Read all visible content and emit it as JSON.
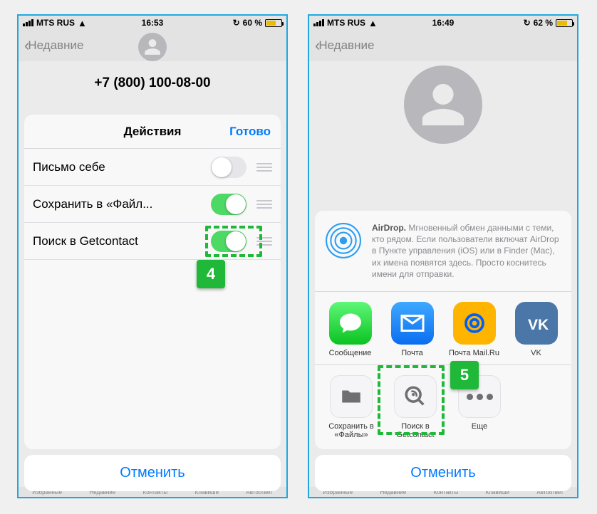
{
  "left": {
    "status": {
      "carrier": "MTS RUS",
      "time": "16:53",
      "battery_pct": "60 %"
    },
    "nav": {
      "back": "Недавние"
    },
    "phone_number": "+7 (800) 100-08-00",
    "actions_title": "Действия",
    "done": "Готово",
    "rows": [
      {
        "label": "Письмо себе",
        "on": false
      },
      {
        "label": "Сохранить в «Файл...",
        "on": true
      },
      {
        "label": "Поиск в Getcontact",
        "on": true
      }
    ],
    "cancel": "Отменить",
    "badge": "4"
  },
  "right": {
    "status": {
      "carrier": "MTS RUS",
      "time": "16:49",
      "battery_pct": "62 %"
    },
    "nav": {
      "back": "Недавние"
    },
    "airdrop": {
      "title": "AirDrop.",
      "body": "Мгновенный обмен данными с теми, кто рядом. Если пользователи включат AirDrop в Пункте управления (iOS) или в Finder (Mac), их имена появятся здесь. Просто коснитесь имени для отправки."
    },
    "apps": [
      {
        "name": "Сообщение"
      },
      {
        "name": "Почта"
      },
      {
        "name": "Почта Mail.Ru"
      },
      {
        "name": "VK"
      }
    ],
    "actions2": [
      {
        "name": "Сохранить в «Файлы»"
      },
      {
        "name": "Поиск в Getcontact"
      },
      {
        "name": "Еще"
      }
    ],
    "cancel": "Отменить",
    "badge": "5"
  },
  "tabbar": [
    "Избранные",
    "Недавние",
    "Контакты",
    "Клавиши",
    "Автоответ"
  ]
}
